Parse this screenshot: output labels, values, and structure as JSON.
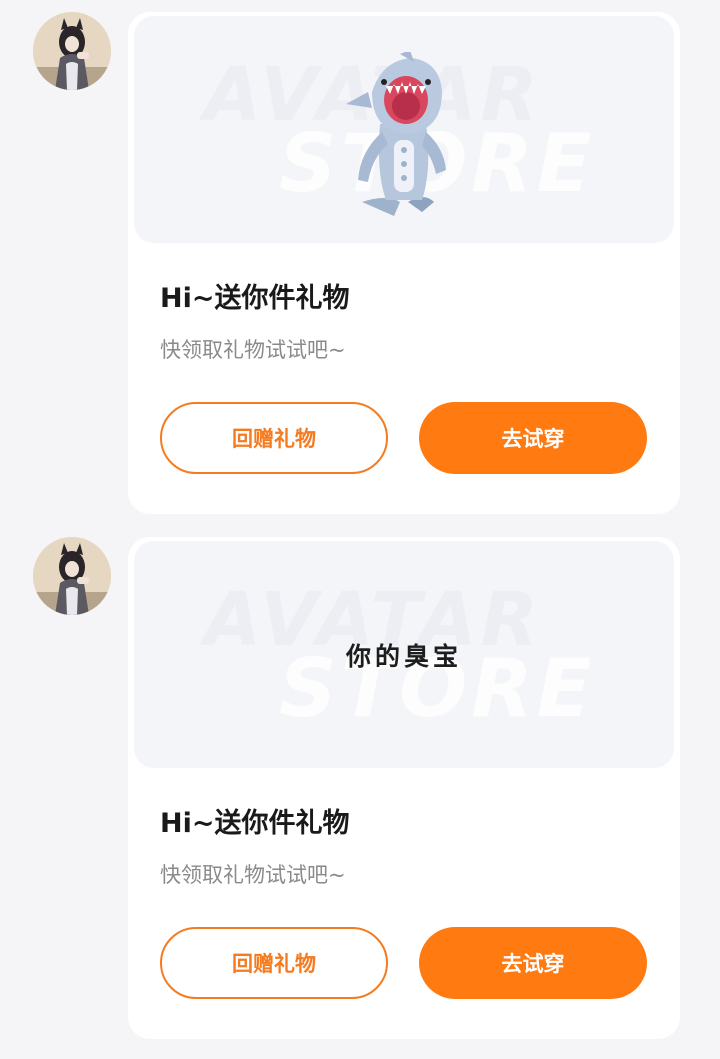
{
  "messages": [
    {
      "avatar_icon": "user-avatar",
      "preview": {
        "watermark_line1": "AVATAR",
        "watermark_line2": "STORE",
        "sticker_icon": "shark-costume-figure",
        "sticker_text": ""
      },
      "title": "Hi~送你件礼物",
      "subtitle": "快领取礼物试试吧~",
      "buttons": {
        "return_gift": "回赠礼物",
        "try_on": "去试穿"
      }
    },
    {
      "avatar_icon": "user-avatar",
      "preview": {
        "watermark_line1": "AVATAR",
        "watermark_line2": "STORE",
        "sticker_icon": "text-sticker",
        "sticker_text": "你的臭宝"
      },
      "title": "Hi~送你件礼物",
      "subtitle": "快领取礼物试试吧~",
      "buttons": {
        "return_gift": "回赠礼物",
        "try_on": "去试穿"
      }
    }
  ],
  "colors": {
    "accent": "#ff7a10",
    "outline": "#f57b20",
    "background": "#f5f5f7"
  }
}
